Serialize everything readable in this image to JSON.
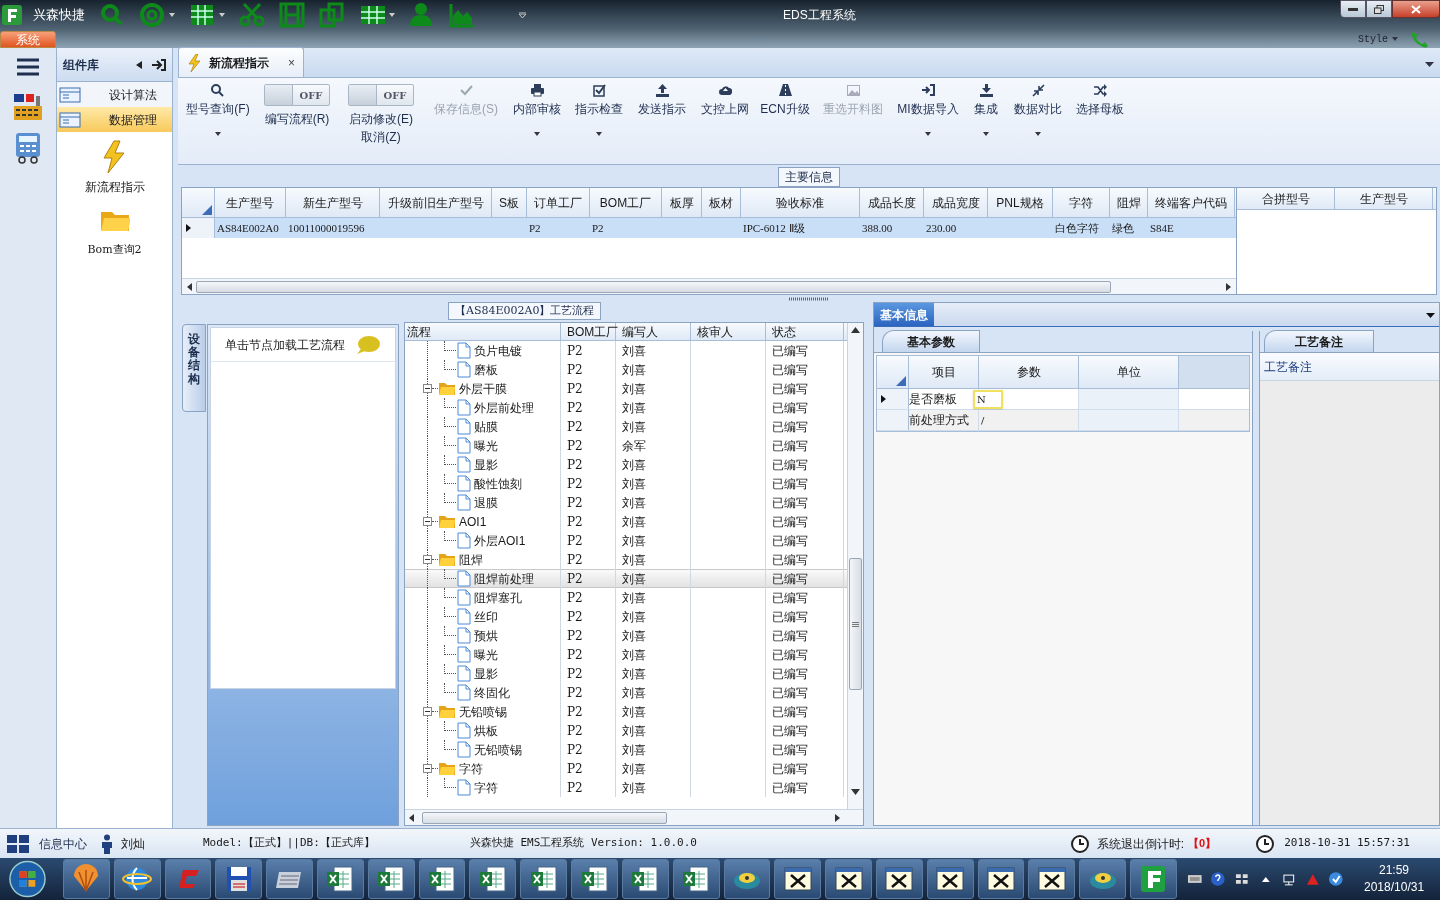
{
  "app": {
    "name": "兴森快捷",
    "title": "EDS工程系统",
    "menu_tab": "系统",
    "style_menu": "Style"
  },
  "sidebar": {
    "title": "组件库",
    "items": [
      {
        "label": "设计算法",
        "selected": false
      },
      {
        "label": "数据管理",
        "selected": true
      }
    ],
    "shortcuts": [
      "新流程指示",
      "Bom查询2"
    ]
  },
  "doc_tab": {
    "label": "新流程指示",
    "close": "×"
  },
  "ribbon": [
    {
      "kind": "button",
      "label": "型号查询(F)",
      "disabled": false,
      "dropdown": true
    },
    {
      "kind": "toggle",
      "label": "编写流程(R)",
      "switch": "OFF",
      "on": false
    },
    {
      "kind": "toggle",
      "label": "启动修改(E)",
      "label2": "取消(Z)",
      "switch": "OFF",
      "on": false
    },
    {
      "kind": "button",
      "label": "保存信息(S)",
      "disabled": true,
      "dropdown": false
    },
    {
      "kind": "button",
      "label": "内部审核",
      "disabled": false,
      "dropdown": true
    },
    {
      "kind": "button",
      "label": "指示检查",
      "disabled": false,
      "dropdown": true
    },
    {
      "kind": "button",
      "label": "发送指示",
      "disabled": false,
      "dropdown": false
    },
    {
      "kind": "button",
      "label": "文控上网",
      "disabled": false,
      "dropdown": false
    },
    {
      "kind": "button",
      "label": "ECN升级",
      "disabled": false,
      "dropdown": false
    },
    {
      "kind": "button",
      "label": "重选开料图",
      "disabled": true,
      "dropdown": false
    },
    {
      "kind": "button",
      "label": "MI数据导入",
      "disabled": false,
      "dropdown": true
    },
    {
      "kind": "button",
      "label": "集成",
      "disabled": false,
      "dropdown": true
    },
    {
      "kind": "button",
      "label": "数据对比",
      "disabled": false,
      "dropdown": true
    },
    {
      "kind": "button",
      "label": "选择母板",
      "disabled": false,
      "dropdown": false
    }
  ],
  "main_info": {
    "title": "主要信息",
    "columns": [
      "生产型号",
      "新生产型号",
      "升级前旧生产型号",
      "S板",
      "订单工厂",
      "BOM工厂",
      "板厚",
      "板材",
      "验收标准",
      "成品长度",
      "成品宽度",
      "PNL规格",
      "字符",
      "阻焊",
      "终端客户代码"
    ],
    "rows": [
      {
        "selected": true,
        "cells": [
          "AS84E002A0",
          "10011000019596",
          null,
          null,
          "P2",
          "P2",
          null,
          null,
          "IPC-6012 Ⅱ级",
          "388.00",
          "230.00",
          null,
          "白色字符",
          "绿色",
          "S84E"
        ]
      }
    ],
    "side_columns": [
      "合拼型号",
      "生产型号"
    ]
  },
  "process": {
    "title": "【AS84E002A0】工艺流程",
    "side_tab": "设备结构",
    "hint": "单击节点加载工艺流程",
    "columns": [
      "流程",
      "BOM工厂",
      "编写人",
      "核审人",
      "状态"
    ],
    "rows": [
      {
        "kind": "continued",
        "children": [
          {
            "kind": "step",
            "label": "负片电镀",
            "bom": "P2",
            "writer": "刘喜",
            "status": "已编写",
            "selected": false
          },
          {
            "kind": "step",
            "label": "磨板",
            "bom": "P2",
            "writer": "刘喜",
            "status": "已编写",
            "selected": false
          }
        ]
      },
      {
        "kind": "folder",
        "label": "外层干膜",
        "bom": "P2",
        "writer": "刘喜",
        "status": "已编写",
        "selected": false,
        "expanded": true,
        "children": [
          {
            "kind": "step",
            "label": "外层前处理",
            "bom": "P2",
            "writer": "刘喜",
            "status": "已编写",
            "selected": false
          },
          {
            "kind": "step",
            "label": "贴膜",
            "bom": "P2",
            "writer": "刘喜",
            "status": "已编写",
            "selected": false
          },
          {
            "kind": "step",
            "label": "曝光",
            "bom": "P2",
            "writer": "余军",
            "status": "已编写",
            "selected": false
          },
          {
            "kind": "step",
            "label": "显影",
            "bom": "P2",
            "writer": "刘喜",
            "status": "已编写",
            "selected": false
          },
          {
            "kind": "step",
            "label": "酸性蚀刻",
            "bom": "P2",
            "writer": "刘喜",
            "status": "已编写",
            "selected": false
          },
          {
            "kind": "step",
            "label": "退膜",
            "bom": "P2",
            "writer": "刘喜",
            "status": "已编写",
            "selected": false
          }
        ]
      },
      {
        "kind": "folder",
        "label": "AOI1",
        "bom": "P2",
        "writer": "刘喜",
        "status": "已编写",
        "selected": false,
        "expanded": true,
        "children": [
          {
            "kind": "step",
            "label": "外层AOI1",
            "bom": "P2",
            "writer": "刘喜",
            "status": "已编写",
            "selected": false
          }
        ]
      },
      {
        "kind": "folder",
        "label": "阻焊",
        "bom": "P2",
        "writer": "刘喜",
        "status": "已编写",
        "selected": false,
        "expanded": true,
        "children": [
          {
            "kind": "step",
            "label": "阻焊前处理",
            "bom": "P2",
            "writer": "刘喜",
            "status": "已编写",
            "selected": true
          },
          {
            "kind": "step",
            "label": "阻焊塞孔",
            "bom": "P2",
            "writer": "刘喜",
            "status": "已编写",
            "selected": false
          },
          {
            "kind": "step",
            "label": "丝印",
            "bom": "P2",
            "writer": "刘喜",
            "status": "已编写",
            "selected": false
          },
          {
            "kind": "step",
            "label": "预烘",
            "bom": "P2",
            "writer": "刘喜",
            "status": "已编写",
            "selected": false
          },
          {
            "kind": "step",
            "label": "曝光",
            "bom": "P2",
            "writer": "刘喜",
            "status": "已编写",
            "selected": false
          },
          {
            "kind": "step",
            "label": "显影",
            "bom": "P2",
            "writer": "刘喜",
            "status": "已编写",
            "selected": false
          },
          {
            "kind": "step",
            "label": "终固化",
            "bom": "P2",
            "writer": "刘喜",
            "status": "已编写",
            "selected": false
          }
        ]
      },
      {
        "kind": "folder",
        "label": "无铅喷锡",
        "bom": "P2",
        "writer": "刘喜",
        "status": "已编写",
        "selected": false,
        "expanded": true,
        "children": [
          {
            "kind": "step",
            "label": "烘板",
            "bom": "P2",
            "writer": "刘喜",
            "status": "已编写",
            "selected": false
          },
          {
            "kind": "step",
            "label": "无铅喷锡",
            "bom": "P2",
            "writer": "刘喜",
            "status": "已编写",
            "selected": false
          }
        ]
      },
      {
        "kind": "folder",
        "label": "字符",
        "bom": "P2",
        "writer": "刘喜",
        "status": "已编写",
        "selected": false,
        "expanded": true,
        "children": [
          {
            "kind": "step",
            "label": "字符",
            "bom": "P2",
            "writer": "刘喜",
            "status": "已编写",
            "selected": false
          }
        ]
      }
    ]
  },
  "basic_info": {
    "tab": "基本信息",
    "subtab": "基本参数",
    "columns": [
      "项目",
      "参数",
      "单位"
    ],
    "rows": [
      {
        "item": "是否磨板",
        "value": "N",
        "selected": true
      },
      {
        "item": "前处理方式",
        "value": "/",
        "selected": false
      }
    ],
    "notes_tab": "工艺备注",
    "notes_label": "工艺备注"
  },
  "status_bar": {
    "info_center": "信息中心",
    "user": "刘灿",
    "model": "Model:【正式】||DB:【正式库】",
    "version": "兴森快捷 EMS工程系统 Version: 1.0.0.0",
    "countdown_label": "系统退出倒计时:",
    "countdown": "【0】",
    "datetime": "2018-10-31 15:57:31"
  },
  "taskbar": {
    "time": "21:59",
    "date": "2018/10/31"
  }
}
